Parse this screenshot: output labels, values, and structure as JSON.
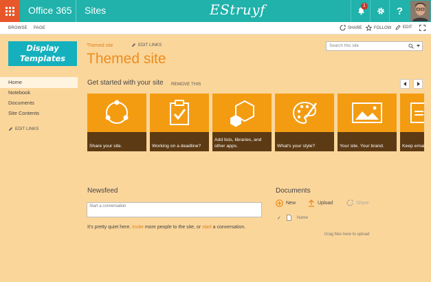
{
  "suite": {
    "brand": "Office 365",
    "app_name": "Sites",
    "logo_text": "EStruyf",
    "notification_count": "1",
    "help_label": "?"
  },
  "ribbon": {
    "tabs": [
      "BROWSE",
      "PAGE"
    ],
    "actions": {
      "share": "SHARE",
      "follow": "FOLLOW",
      "edit": "EDIT"
    }
  },
  "nav": {
    "logo_line1": "Display",
    "logo_line2": "Templates",
    "items": [
      "Home",
      "Notebook",
      "Documents",
      "Site Contents"
    ],
    "edit_links": "EDIT LINKS"
  },
  "header": {
    "breadcrumb": "Themed site",
    "edit_links": "EDIT LINKS",
    "title": "Themed site",
    "search_placeholder": "Search this site"
  },
  "get_started": {
    "title": "Get started with your site",
    "remove": "REMOVE THIS",
    "tiles": [
      {
        "label": "Share your site.",
        "icon": "share-icon"
      },
      {
        "label": "Working on a deadline?",
        "icon": "clipboard-check-icon"
      },
      {
        "label": "Add lists, libraries, and other apps.",
        "icon": "hexagon-apps-icon"
      },
      {
        "label": "What's your style?",
        "icon": "palette-icon"
      },
      {
        "label": "Your site. Your brand.",
        "icon": "image-icon"
      },
      {
        "label": "Keep email",
        "icon": "mail-icon"
      }
    ]
  },
  "newsfeed": {
    "title": "Newsfeed",
    "placeholder": "Start a conversation",
    "quiet_pre": "It's pretty quiet here. ",
    "quiet_invite": "Invite",
    "quiet_mid": " more people to the site, or ",
    "quiet_start": "start",
    "quiet_post": " a conversation."
  },
  "documents": {
    "title": "Documents",
    "new": "New",
    "upload": "Upload",
    "share": "Share",
    "column_name": "Name",
    "drag_hint": "Drag files here to upload"
  },
  "colors": {
    "suite_bar": "#20b2ab",
    "waffle": "#e8572a",
    "page_bg": "#fbd69b",
    "accent": "#ec8d1e",
    "tile": "#f39c12",
    "tile_caption": "#5c3a14"
  }
}
